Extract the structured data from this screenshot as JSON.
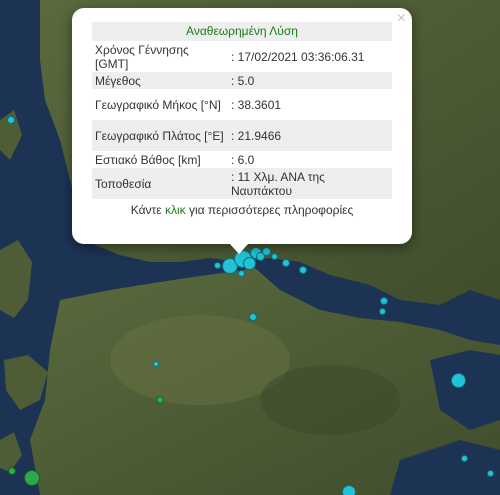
{
  "popup": {
    "title": "Αναθεωρημένη Λύση",
    "close_symbol": "×",
    "rows": [
      {
        "label": "Χρόνος Γέννησης [GMT]",
        "value": ": 17/02/2021 03:36:06.31"
      },
      {
        "label": "Μέγεθος",
        "value": ": 5.0"
      },
      {
        "label": "Γεωγραφικό Μήκος [°N]",
        "value": ": 38.3601"
      },
      {
        "label": "Γεωγραφικό Πλάτος [°E]",
        "value": ": 21.9466"
      },
      {
        "label": "Εστιακό Βάθος [km]",
        "value": ": 6.0"
      },
      {
        "label": "Τοποθεσία",
        "value": ": 11 Χλμ. ΑΝΑ της Ναυπάκτου"
      }
    ],
    "more_prefix": "Κάντε",
    "more_link": "κλικ",
    "more_suffix": "για περισσότερες πληροφορίες"
  },
  "map_colors": {
    "sea": "#1c3354",
    "land": "#4a5a34",
    "quake_recent": "#22c3d6",
    "quake_old": "#2fa84a"
  }
}
